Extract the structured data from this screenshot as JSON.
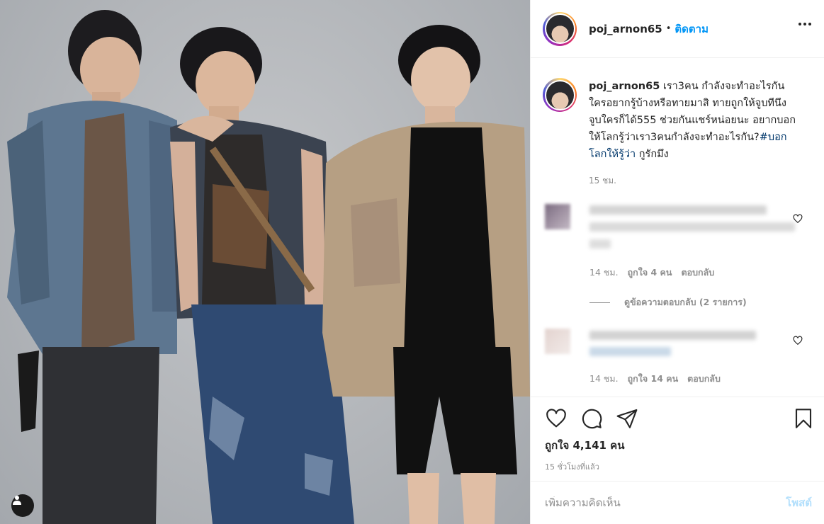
{
  "photo": {
    "alt_icon": "person-tag-icon"
  },
  "header": {
    "username": "poj_arnon65",
    "separator": "•",
    "follow_label": "ติดตาม",
    "more_icon": "more-horizontal-icon"
  },
  "caption": {
    "username": "poj_arnon65",
    "text": " เรา3คน กำลังจะทำอะไรกัน ใครอยากรู้บ้างหรือทายมาสิ ทายถูกให้จูบทีนึง จูบใครก็ได้555 ช่วยกันแชร์หน่อยนะ อยากบอกให้โลกรู้ว่าเรา3คนกำลังจะทำอะไรกัน?",
    "hashtag": "#บอกโลกให้รู้ว่า",
    "text_after": " กูรักมึง",
    "time": "15 ชม."
  },
  "comments": [
    {
      "time": "14 ชม.",
      "likes": "ถูกใจ 4 คน",
      "reply_label": "ตอบกลับ",
      "view_replies": "ดูข้อความตอบกลับ (2 รายการ)"
    },
    {
      "time": "14 ชม.",
      "likes": "ถูกใจ 14 คน",
      "reply_label": "ตอบกลับ"
    }
  ],
  "actions": {
    "icons": [
      "heart-icon",
      "comment-icon",
      "share-icon",
      "bookmark-icon"
    ],
    "likes_label": "ถูกใจ 4,141 คน",
    "posted_time": "15 ชั่วโมงที่แล้ว"
  },
  "add_comment": {
    "placeholder": "เพิ่มความคิดเห็น",
    "post_label": "โพสต์"
  },
  "colors": {
    "accent": "#0095f6",
    "post_disabled": "#b2dffc",
    "muted": "#8e8e8e",
    "text": "#262626"
  }
}
